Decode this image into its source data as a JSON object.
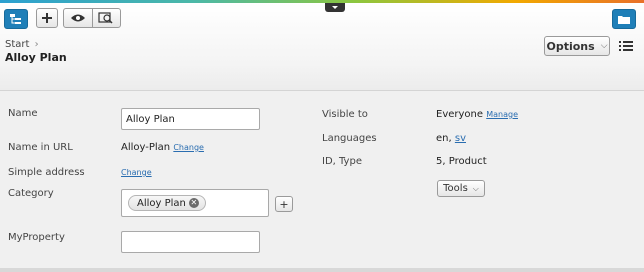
{
  "toolbar": {
    "navigation_icon": "tree-icon",
    "add_icon": "plus-icon",
    "view_icon": "eye-icon",
    "preview_icon": "preview-icon",
    "assets_icon": "folder-icon",
    "brand_strip_colors": [
      "#2ca0d0",
      "#8cc63f",
      "#f2a900",
      "#e8702a"
    ]
  },
  "header": {
    "breadcrumb": "Start",
    "breadcrumb_separator": "›",
    "title": "Alloy Plan",
    "options_label": "Options",
    "options_chevron": "⌵"
  },
  "form": {
    "name_label": "Name",
    "name_value": "Alloy Plan",
    "url_label": "Name in URL",
    "url_value": "Alloy-Plan",
    "url_change": "Change",
    "simple_address_label": "Simple address",
    "simple_address_change": "Change",
    "category_label": "Category",
    "category_chip": "Alloy Plan",
    "category_add": "+",
    "myproperty_label": "MyProperty",
    "myproperty_value": ""
  },
  "info": {
    "visible_label": "Visible to",
    "visible_value": "Everyone",
    "visible_manage": "Manage",
    "languages_label": "Languages",
    "languages_current": "en,",
    "languages_other": "sv",
    "id_label": "ID, Type",
    "id_value": "5, Product",
    "tools_label": "Tools"
  },
  "colors": {
    "accent": "#1f7fb8",
    "link": "#2a6db0"
  }
}
